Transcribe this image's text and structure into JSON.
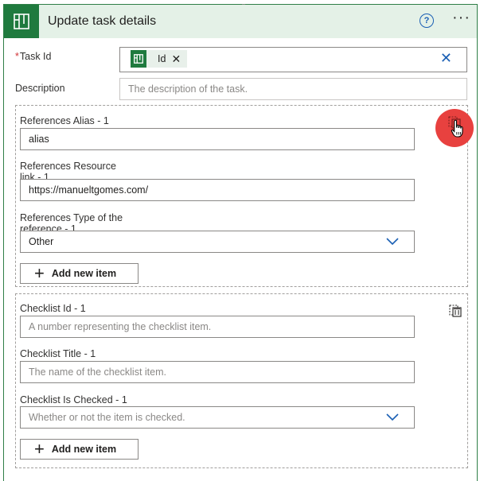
{
  "header": {
    "title": "Update task details",
    "help_label": "?",
    "more_label": "···"
  },
  "task_id": {
    "label": "Task Id",
    "required_mark": "*",
    "token_label": "Id",
    "token_remove": "✕",
    "clear": "✕"
  },
  "description": {
    "label": "Description",
    "placeholder": "The description of the task."
  },
  "references": {
    "alias_label": "References Alias - 1",
    "alias_value": "alias",
    "resource_label_line1": "References Resource",
    "resource_label_line2": "link - 1",
    "resource_value": "https://manueltgomes.com/",
    "type_label_line1": "References Type of the",
    "type_label_line2": "reference - 1",
    "type_value": "Other",
    "add_label": "Add new item"
  },
  "checklist": {
    "id_label": "Checklist Id - 1",
    "id_placeholder": "A number representing the checklist item.",
    "title_label": "Checklist Title - 1",
    "title_placeholder": "The name of the checklist item.",
    "checked_label": "Checklist Is Checked - 1",
    "checked_placeholder": "Whether or not the item is checked.",
    "add_label": "Add new item"
  },
  "icons": {
    "app": "planner-icon",
    "token": "planner-icon",
    "remove_group": "clipboard-delete-icon",
    "cursor": "hand-cursor-icon",
    "chevron": "chevron-down-icon",
    "plus": "plus-icon"
  },
  "colors": {
    "brand_green": "#1f7a3e",
    "header_bg": "#e4f1e7",
    "accent_blue": "#1a5fb4",
    "highlight_red": "#e8413f",
    "required_red": "#d13438"
  }
}
